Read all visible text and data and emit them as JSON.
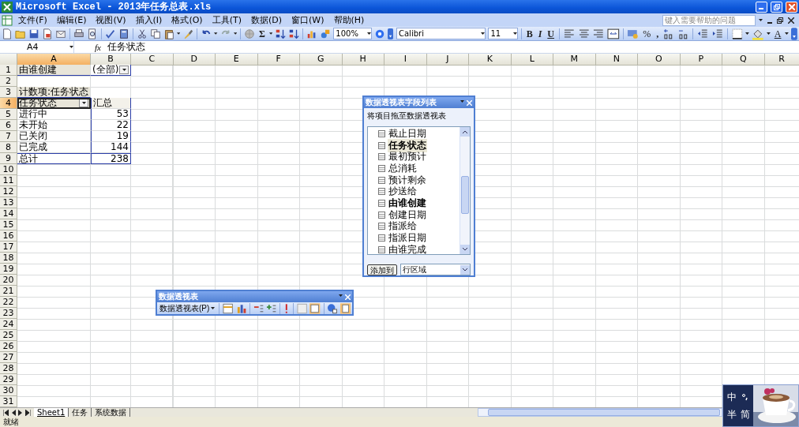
{
  "window": {
    "title": "Microsoft Excel - 2013年任务总表.xls"
  },
  "menu": [
    "文件(F)",
    "编辑(E)",
    "视图(V)",
    "插入(I)",
    "格式(O)",
    "工具(T)",
    "数据(D)",
    "窗口(W)",
    "帮助(H)"
  ],
  "help_search": {
    "placeholder": "键入需要帮助的问题"
  },
  "standard_toolbar": {
    "autosum": "Σ",
    "zoom": "100%"
  },
  "formatting_toolbar": {
    "font": "Calibri",
    "font_size": "11",
    "bold": "B",
    "italic": "I",
    "underline": "U",
    "percent": "%",
    "comma": ",",
    "font_color": "A"
  },
  "formula_bar": {
    "name_box": "A4",
    "function_label": "fx",
    "content": "任务状态"
  },
  "columns": [
    {
      "label": "A",
      "selected": true
    },
    {
      "label": "B",
      "selected": false
    },
    {
      "label": "C",
      "selected": false
    },
    {
      "label": "D",
      "selected": false
    },
    {
      "label": "E",
      "selected": false
    },
    {
      "label": "F",
      "selected": false
    },
    {
      "label": "G",
      "selected": false
    },
    {
      "label": "H",
      "selected": false
    },
    {
      "label": "I",
      "selected": false
    },
    {
      "label": "J",
      "selected": false
    },
    {
      "label": "K",
      "selected": false
    },
    {
      "label": "L",
      "selected": false
    },
    {
      "label": "M",
      "selected": false
    },
    {
      "label": "N",
      "selected": false
    },
    {
      "label": "O",
      "selected": false
    },
    {
      "label": "P",
      "selected": false
    },
    {
      "label": "Q",
      "selected": false
    },
    {
      "label": "R",
      "selected": false
    }
  ],
  "rows": [
    {
      "number": "1",
      "selected": false,
      "cells": [
        {
          "text": "由谁创建",
          "kind": "field"
        },
        {
          "text": "(全部)",
          "kind": "dropdown"
        }
      ]
    },
    {
      "number": "2",
      "selected": false
    },
    {
      "number": "3",
      "selected": false,
      "cells": [
        {
          "text": "计数项:任务状态",
          "kind": "field"
        }
      ]
    },
    {
      "number": "4",
      "selected": true,
      "cells": [
        {
          "text": "任务状态",
          "kind": "field_dropdown"
        },
        {
          "text": "汇总",
          "kind": "header"
        }
      ]
    },
    {
      "number": "5",
      "selected": false,
      "cells": [
        {
          "text": "进行中",
          "kind": "text"
        },
        {
          "text": "53",
          "kind": "number"
        }
      ]
    },
    {
      "number": "6",
      "selected": false,
      "cells": [
        {
          "text": "未开始",
          "kind": "text"
        },
        {
          "text": "22",
          "kind": "number"
        }
      ]
    },
    {
      "number": "7",
      "selected": false,
      "cells": [
        {
          "text": "已关闭",
          "kind": "text"
        },
        {
          "text": "19",
          "kind": "number"
        }
      ]
    },
    {
      "number": "8",
      "selected": false,
      "cells": [
        {
          "text": "已完成",
          "kind": "text"
        },
        {
          "text": "144",
          "kind": "number"
        }
      ]
    },
    {
      "number": "9",
      "selected": false,
      "cells": [
        {
          "text": "总计",
          "kind": "total"
        },
        {
          "text": "238",
          "kind": "total_number"
        }
      ]
    },
    {
      "number": "10",
      "selected": false
    },
    {
      "number": "11",
      "selected": false
    },
    {
      "number": "12",
      "selected": false
    },
    {
      "number": "13",
      "selected": false
    },
    {
      "number": "14",
      "selected": false
    },
    {
      "number": "15",
      "selected": false
    },
    {
      "number": "16",
      "selected": false
    },
    {
      "number": "17",
      "selected": false
    },
    {
      "number": "18",
      "selected": false
    },
    {
      "number": "19",
      "selected": false
    },
    {
      "number": "20",
      "selected": false
    },
    {
      "number": "21",
      "selected": false
    },
    {
      "number": "22",
      "selected": false
    },
    {
      "number": "23",
      "selected": false
    },
    {
      "number": "24",
      "selected": false
    },
    {
      "number": "25",
      "selected": false
    },
    {
      "number": "26",
      "selected": false
    },
    {
      "number": "27",
      "selected": false
    },
    {
      "number": "28",
      "selected": false
    },
    {
      "number": "29",
      "selected": false
    },
    {
      "number": "30",
      "selected": false
    },
    {
      "number": "31",
      "selected": false
    }
  ],
  "sheet_tabs": [
    {
      "label": "Sheet1",
      "selected": true
    },
    {
      "label": "任务",
      "selected": false
    },
    {
      "label": "系统数据",
      "selected": false
    }
  ],
  "status_bar": "就绪",
  "pivot_field_list": {
    "title": "数据透视表字段列表",
    "hint": "将项目拖至数据透视表",
    "fields": [
      {
        "label": "截止日期",
        "used": false,
        "selected": false
      },
      {
        "label": "任务状态",
        "used": true,
        "selected": true
      },
      {
        "label": "最初预计",
        "used": false,
        "selected": false
      },
      {
        "label": "总消耗",
        "used": false,
        "selected": false
      },
      {
        "label": "预计剩余",
        "used": false,
        "selected": false
      },
      {
        "label": "抄送给",
        "used": false,
        "selected": false
      },
      {
        "label": "由谁创建",
        "used": true,
        "selected": false
      },
      {
        "label": "创建日期",
        "used": false,
        "selected": false
      },
      {
        "label": "指派给",
        "used": false,
        "selected": false
      },
      {
        "label": "指派日期",
        "used": false,
        "selected": false
      },
      {
        "label": "由谁完成",
        "used": false,
        "selected": false
      }
    ],
    "add_button": "添加到",
    "area": "行区域"
  },
  "pivot_toolbar": {
    "title": "数据透视表",
    "menu": "数据透视表(P)"
  },
  "ime": {
    "mode": "中",
    "width": "半",
    "script": "简"
  }
}
